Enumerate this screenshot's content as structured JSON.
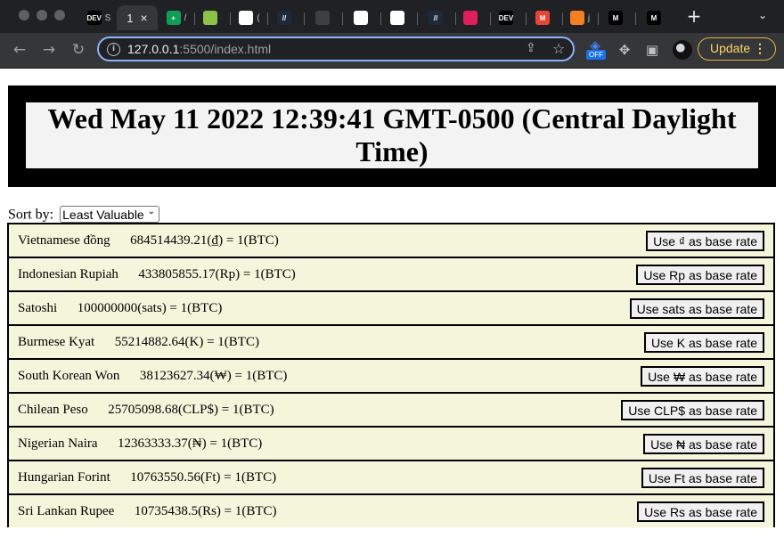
{
  "browser": {
    "tabs": [
      {
        "favicon": "DEV",
        "label": "S",
        "color": "#000000"
      },
      {
        "favicon": "",
        "label": "1",
        "active": true
      },
      {
        "favicon": "+",
        "label": "/",
        "color": "#0f9d58"
      },
      {
        "favicon": "",
        "label": "",
        "color": "#8bc34a"
      },
      {
        "favicon": "",
        "label": "(",
        "color": "#ffffff"
      },
      {
        "favicon": "//",
        "label": "",
        "color": "#1e2a3a"
      },
      {
        "favicon": "",
        "label": "",
        "color": "#3c4043"
      },
      {
        "favicon": "",
        "label": "",
        "color": "#ffffff"
      },
      {
        "favicon": "",
        "label": "",
        "color": "#ffffff"
      },
      {
        "favicon": "//",
        "label": "",
        "color": "#1e2a3a"
      },
      {
        "favicon": "",
        "label": "",
        "color": "#e01e5a"
      },
      {
        "favicon": "DEV",
        "label": "",
        "color": "#000000"
      },
      {
        "favicon": "M",
        "label": "",
        "color": "#ea4335"
      },
      {
        "favicon": "",
        "label": "j",
        "color": "#f48024"
      },
      {
        "favicon": "M",
        "label": "",
        "color": "#000000"
      },
      {
        "favicon": "M",
        "label": "",
        "color": "#000000"
      }
    ],
    "url_host": "127.0.0.1",
    "url_rest": ":5500/index.html",
    "off_badge": "OFF",
    "update_label": "Update",
    "update_dots": "⋮"
  },
  "page": {
    "datetime": "Wed May 11 2022 12:39:41 GMT-0500 (Central Daylight Time)",
    "sort_label": "Sort by:",
    "sort_value": "Least Valuable",
    "rates": [
      {
        "name": "Vietnamese đồng",
        "amount": "684514439.21",
        "symbol": "₫",
        "button": "Use ₫ as base rate"
      },
      {
        "name": "Indonesian Rupiah",
        "amount": "433805855.17",
        "symbol": "Rp",
        "button": "Use Rp as base rate"
      },
      {
        "name": "Satoshi",
        "amount": "100000000",
        "symbol": "sats",
        "button": "Use sats as base rate"
      },
      {
        "name": "Burmese Kyat",
        "amount": "55214882.64",
        "symbol": "K",
        "button": "Use K as base rate"
      },
      {
        "name": "South Korean Won",
        "amount": "38123627.34",
        "symbol": "₩",
        "button": "Use ₩ as base rate"
      },
      {
        "name": "Chilean Peso",
        "amount": "25705098.68",
        "symbol": "CLP$",
        "button": "Use CLP$ as base rate"
      },
      {
        "name": "Nigerian Naira",
        "amount": "12363333.37",
        "symbol": "₦",
        "button": "Use ₦ as base rate"
      },
      {
        "name": "Hungarian Forint",
        "amount": "10763550.56",
        "symbol": "Ft",
        "button": "Use Ft as base rate"
      },
      {
        "name": "Sri Lankan Rupee",
        "amount": "10735438.5",
        "symbol": "Rs",
        "button": "Use Rs as base rate"
      }
    ],
    "base_suffix": "1(BTC)"
  }
}
